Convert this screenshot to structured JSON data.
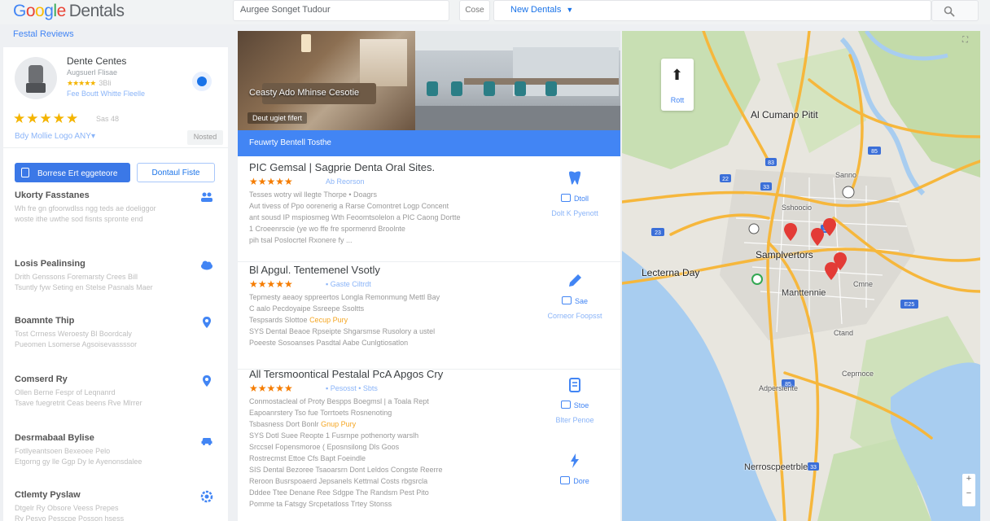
{
  "header": {
    "logo_brand": "Google",
    "logo_suffix": "Dentals",
    "search_placeholder": "Aurgee Songet Tudour",
    "close_btn": "Cose",
    "filter_label": "New Dentals",
    "search_icon": "search-icon",
    "brand_colors": [
      "#4285f4",
      "#ea4335",
      "#fbbc05",
      "#4285f4",
      "#34a853",
      "#ea4335"
    ]
  },
  "subheader_link": "Festal Reviews",
  "profile": {
    "name": "Dente Centes",
    "subtitle": "Augsuerl Flisae",
    "small_rating_text": "3Bli",
    "link": "Fee Boutt Whitte Fleelle",
    "stars": "★★★★★",
    "review_count": "Sas 48",
    "action": "Bdy Mollie Logo ANY▾",
    "save_label": "Nosted"
  },
  "buttons": {
    "primary": "Borrese Ert eggeteore",
    "outline": "Dontaul Fiste"
  },
  "sidebar_items": [
    {
      "title": "Ukorty Fasstanes",
      "line1": "Wh fre gn gfoorwdlss ngg teds ae doeliggor",
      "line2": "woste ithe uwthe sod fisnts spronte end",
      "line3": "vieolle arei ong hsy lot fios.",
      "icon": "people-icon"
    },
    {
      "title": "Losis Pealinsing",
      "line1": "Drith Genssons Foremarsty Crees Bill",
      "line2": "Tsuntly fyw Seting en Stelse Pasnals Maer",
      "line3": "Maeo.",
      "icon": "cloud-icon"
    },
    {
      "title": "Boamnte Thip",
      "line1": "Tost Crrness Weroesty Bl Boordcaly",
      "line2": "Pueomen Lsomerse Agsoisevassssor",
      "line3": "Desprelbcrtriy Wiiese Apgeanrosl",
      "icon": "location-pin-icon"
    },
    {
      "title": "Comserd Ry",
      "line1": "Ollen Berne Fespr of Leqnanrd",
      "line2": "Tsave fuegretrit Ceas beens Rve Mlrrer",
      "line3": "lo Porse wth Beeoll arsesnamitts",
      "icon": "location-pin-icon"
    },
    {
      "title": "Desrmabaal Bylise",
      "line1": "Fotllyeantsoen Bexeoee Pelo",
      "line2": "Etgorng gy lle Ggp Dy le Ayenonsdalee",
      "line3": "Dssiqo Bunisctse Ds",
      "icon": "car-icon"
    },
    {
      "title": "Ctlemty Pyslaw",
      "line1": "Dtgelr Ry Obsore Veess Prepes",
      "line2": "Ry Pesyo Pesscpe Posson hsess",
      "line3": "",
      "icon": "settings-icon"
    }
  ],
  "hero": {
    "title": "Ceasty Ado Mhinse Cesotie",
    "chip": "Deut ugiet fifert",
    "strip_text": "Feuwrty Bentell Tosthe"
  },
  "results": [
    {
      "title": "PIC Gemsal | Sagprie Denta Oral Sites.",
      "stars": "★★★★★",
      "meta": "Ab Reorson",
      "lines": [
        "Tesses wotry wil llegte Thorpe • Doagrs",
        "Aut tivess of Ppo oorenerig a Rarse Comontret Logp Concent",
        "ant sousd IP mspiosmeg Wth Feoomtsolelon a PIC Caong Dortte",
        "1 Croeenrscie (ye wo ffe fre spormenrd Broolnte",
        "pih tsal Poslocrtel Rxonere fy ..."
      ],
      "highlight": "",
      "side_label": "Dtoll",
      "side_caption": "Dolt K Pyenott",
      "icon": "tooth-icon"
    },
    {
      "title": "Bl Apgul. Tentemenel Vsotly",
      "stars": "★★★★★",
      "meta": "▪ Gaste Ciltrdt",
      "lines": [
        "Tepmesty aeaoy sppreertos Longla Remonmung Mettl Bay",
        "C aalo Pecdoyaipe Ssreepe Ssoltts",
        "Tespsards Slottoe"
      ],
      "highlight": "Cecup Pury",
      "lines_after": [
        "SYS Dental Beaoe Rpseipte Shgarsmse Rusolory a ustel",
        "Poeeste Sosoanses Pasdtal Aabe Cunlgtiosatlon"
      ],
      "side_label": "Sae",
      "side_caption": "Corneor Foopsst",
      "icon": "pen-icon"
    },
    {
      "title": "All Tersmoontical Pestalal PcA Apgos Cry",
      "stars": "★★★★★",
      "meta": "▪ Pesosst • Sbts",
      "lines": [
        "Conmostacleal of Proty Bespps Boegmsl | a Toala Rept",
        "Eapoanrstery Tso fue Torrtoets Rosnenoting",
        "Tsbasness Dort Bonlr"
      ],
      "highlight": "Gnup Pury",
      "lines_after": [
        "SYS Dotl Suee Reopte 1 Fusrnpe pothenorty warslh",
        "Srccsel Fopensmoroe ( Eposnsilong Dls Goos",
        "Rostrecmst Ettoe Cfs Bapt Foeindle",
        "SIS Dental Bezoree Tsaoarsrn Dont Leldos Congste Reerre",
        "Reroon Busrspoaerd Jepsanels Kettmal Costs rbgsrcla",
        "Dddee Ttee Denane Ree Sdgpe The Randsm Pest Pito",
        "Pomme ta Fatsgy Srcpetatloss Trtey Stonss"
      ],
      "side_label": "Stoe",
      "side_caption": "Blter Penoe",
      "icon": "clipboard-icon"
    }
  ],
  "last_side_label": "Dore",
  "map": {
    "compass_label": "Rott",
    "labels": {
      "al_cumano": "Al Cumano Pitit",
      "sanno": "Sanno",
      "sshooclo": "Sshoocio",
      "a": "A",
      "lecterna_day": "Lecterna Day",
      "sampverton": "Samplvertors",
      "manttennie": "Manttennie",
      "cmne": "Cmne",
      "ctand": "Ctand",
      "cepronce": "Ceprnoce",
      "adpersiente": "Adpersiente",
      "neronsperabte": "Nerroscpeetrble"
    },
    "shield_labels": [
      "33",
      "23",
      "85",
      "85",
      "85",
      "33",
      "83",
      "33",
      "22",
      "E25"
    ],
    "zoom_plus": "+",
    "zoom_minus": "−",
    "colors": {
      "land": "#e8e6df",
      "park": "#bfd9a8",
      "water": "#a8cdf0",
      "highway": "#f6b73c",
      "pin": "#e33b36"
    }
  }
}
